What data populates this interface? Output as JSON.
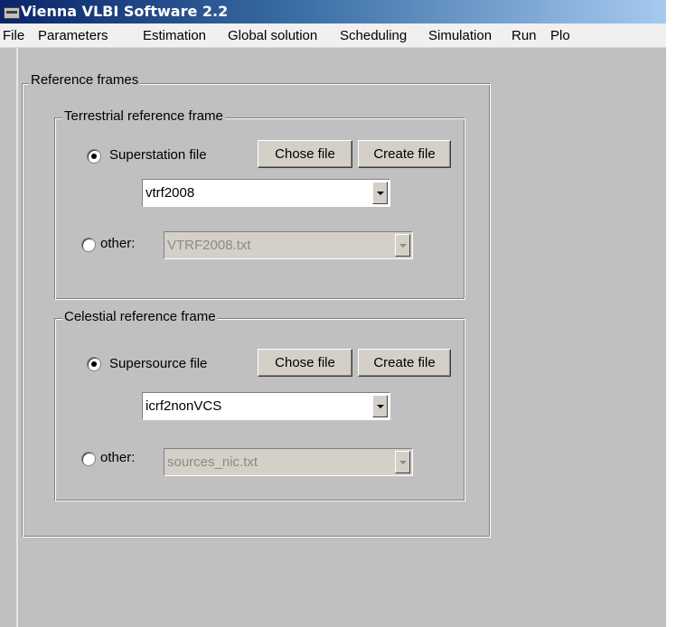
{
  "window": {
    "title": "Vienna VLBI Software 2.2"
  },
  "menu": [
    "File",
    "Parameters",
    "Estimation",
    "Global solution",
    "Scheduling",
    "Simulation",
    "Run",
    "Plo"
  ],
  "reference_frames": {
    "legend": "Reference frames",
    "terrestrial": {
      "legend": "Terrestrial reference frame",
      "superstation_label": "Superstation file",
      "superstation_selected": true,
      "chose_button": "Chose file",
      "create_button": "Create file",
      "dropdown_value": "vtrf2008",
      "other_label": "other:",
      "other_selected": false,
      "other_value": "VTRF2008.txt"
    },
    "celestial": {
      "legend": "Celestial reference frame",
      "supersource_label": "Supersource file",
      "supersource_selected": true,
      "chose_button": "Chose file",
      "create_button": "Create file",
      "dropdown_value": "icrf2nonVCS",
      "other_label": "other:",
      "other_selected": false,
      "other_value": "sources_nic.txt"
    }
  }
}
